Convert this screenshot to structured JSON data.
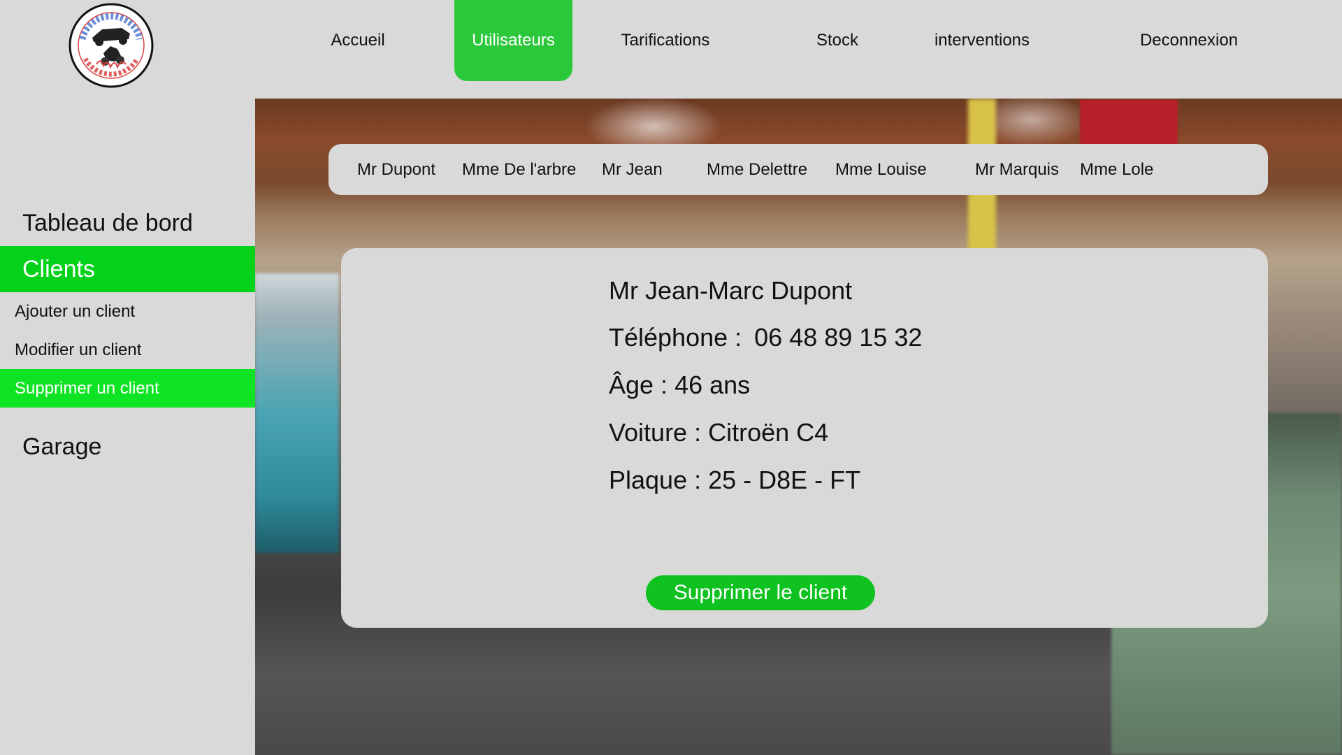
{
  "logo": {
    "text_top": "BENZIN GARAGE & CO",
    "text_bottom": "AUTO & MOTO"
  },
  "nav": {
    "items": [
      {
        "label": "Accueil",
        "active": false
      },
      {
        "label": "Utilisateurs",
        "active": true
      },
      {
        "label": "Tarifications",
        "active": false
      },
      {
        "label": "Stock",
        "active": false
      },
      {
        "label": "interventions",
        "active": false
      },
      {
        "label": "Deconnexion",
        "active": false
      }
    ]
  },
  "sidebar": {
    "dashboard": "Tableau de bord",
    "clients": "Clients",
    "add_client": "Ajouter un client",
    "edit_client": "Modifier un client",
    "delete_client": "Supprimer un client",
    "garage": "Garage"
  },
  "client_tabs": [
    "Mr Dupont",
    "Mme De l'arbre",
    "Mr Jean",
    "Mme Delettre",
    "Mme Louise",
    "Mr Marquis",
    "Mme Lole"
  ],
  "client_detail": {
    "name": "Mr Jean-Marc Dupont",
    "phone_label": "Téléphone : ",
    "phone_value": "06 48 89 15 32",
    "age_label": "Âge : ",
    "age_value": "46 ans",
    "car_label": "Voiture : ",
    "car_value": "Citroën C4",
    "plate_label": "Plaque : ",
    "plate_value": "25 - D8E - FT",
    "delete_button": "Supprimer le client"
  },
  "colors": {
    "background": "#d9d9d9",
    "nav_active": "#2cc83c",
    "sidebar_clients": "#03d11a",
    "sidebar_delete": "#0ee423",
    "button": "#0fc21f"
  }
}
